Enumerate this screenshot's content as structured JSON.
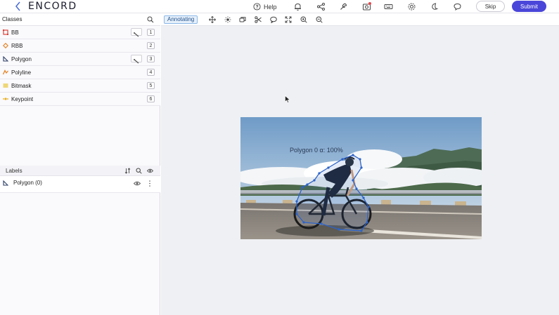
{
  "header": {
    "logo": "ENCORD",
    "help_label": "Help",
    "skip_label": "Skip",
    "submit_label": "Submit",
    "icons": [
      "back-arrow-icon",
      "help-icon",
      "bell-icon",
      "share-icon",
      "wrench-icon",
      "camera-icon",
      "keyboard-icon",
      "settings-icon",
      "moon-icon",
      "chat-icon"
    ]
  },
  "classes": {
    "title": "Classes",
    "items": [
      {
        "label": "BB",
        "key": "1",
        "icon": "bounding-box-icon",
        "color": "#d9423a"
      },
      {
        "label": "RBB",
        "key": "2",
        "icon": "rotated-box-icon",
        "color": "#e3862a"
      },
      {
        "label": "Polygon",
        "key": "3",
        "icon": "polygon-icon",
        "color": "#2c3e66"
      },
      {
        "label": "Polyline",
        "key": "4",
        "icon": "polyline-icon",
        "color": "#e3862a"
      },
      {
        "label": "Bitmask",
        "key": "5",
        "icon": "bitmask-icon",
        "color": "#e8c32a"
      },
      {
        "label": "Keypoint",
        "key": "6",
        "icon": "keypoint-icon",
        "color": "#e8b020"
      }
    ]
  },
  "labels": {
    "title": "Labels",
    "items": [
      {
        "label": "Polygon (0)"
      }
    ]
  },
  "toolbar": {
    "mode_label": "Annotating",
    "tools": [
      "move-icon",
      "brightness-icon",
      "layers-icon",
      "scissors-icon",
      "comment-icon",
      "fit-icon",
      "zoom-in-icon",
      "zoom-out-icon"
    ]
  },
  "canvas": {
    "annotation_label": "Polygon 0 α: 100%",
    "accent": "#2d63c8"
  }
}
